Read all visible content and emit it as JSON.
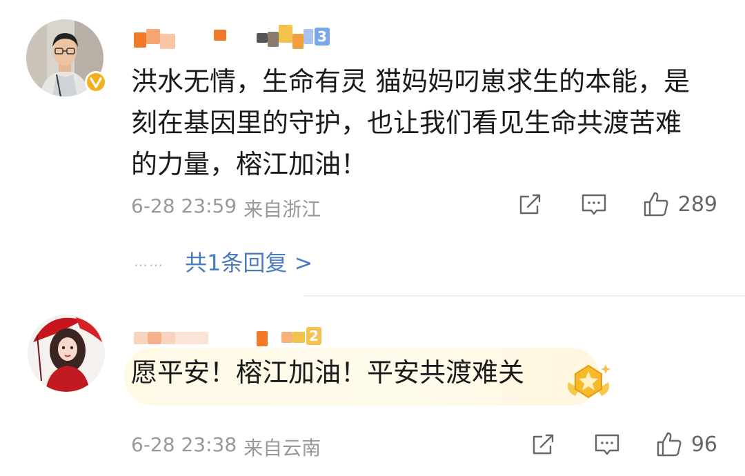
{
  "comments": [
    {
      "username": "",
      "level": "3",
      "level_color": "#7aa7e8",
      "text": "洪水无情，生命有灵 猫妈妈叼崽求生的本能，是\n刻在基因里的守护，也让我们看见生命共渡苦难\n的力量，榕江加油！",
      "timestamp": "6-28 23:59",
      "location": "来自浙江",
      "like_count": "289",
      "replies_label": "共1条回复 >",
      "replies_dots": "……"
    },
    {
      "username": "",
      "level": "2",
      "level_color": "#f5c150",
      "text": "愿平安！榕江加油！平安共渡难关",
      "timestamp": "6-28 23:38",
      "location": "来自云南",
      "like_count": "96"
    }
  ],
  "icons": {
    "share": "share-icon",
    "reply": "comment-icon",
    "like": "thumbs-up-icon",
    "verified": "verified-v-badge-icon",
    "award": "gold-award-icon"
  },
  "colors": {
    "link": "#4a7bc1",
    "meta": "#999999",
    "verified_badge": "#f2b01e"
  }
}
